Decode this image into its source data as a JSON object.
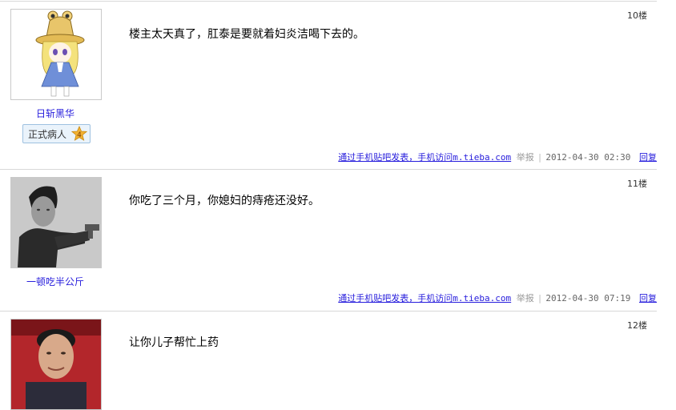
{
  "posts": [
    {
      "floor": "10楼",
      "username": "日斩黑华",
      "badge": {
        "label": "正式病人",
        "level": "4"
      },
      "content": "楼主太天真了，肛泰是要就着妇炎洁喝下去的。",
      "tail": {
        "via_link": "通过手机贴吧发表，手机访问",
        "domain": "m.tieba.com",
        "report": "举报",
        "time": "2012-04-30 02:30",
        "reply": "回复"
      }
    },
    {
      "floor": "11楼",
      "username": "一顿吃半公斤",
      "content": "你吃了三个月，你媳妇的痔疮还没好。",
      "tail": {
        "via_link": "通过手机贴吧发表，手机访问",
        "domain": "m.tieba.com",
        "report": "举报",
        "time": "2012-04-30 07:19",
        "reply": "回复"
      }
    },
    {
      "floor": "12楼",
      "content": "让你儿子帮忙上药"
    }
  ]
}
